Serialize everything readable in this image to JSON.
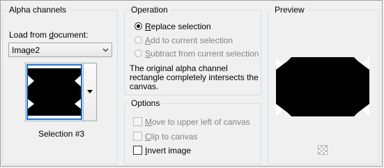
{
  "alpha": {
    "title": "Alpha channels",
    "load_label_pre": "Load from ",
    "load_label_u": "d",
    "load_label_post": "ocument:",
    "document_value": "Image2",
    "selection_label": "Selection #3"
  },
  "operation": {
    "title": "Operation",
    "replace": {
      "u": "R",
      "rest": "eplace selection",
      "selected": true,
      "enabled": true
    },
    "add": {
      "u": "A",
      "rest": "dd to current selection",
      "selected": false,
      "enabled": false
    },
    "subtract": {
      "u": "S",
      "rest": "ubtract from current selection",
      "selected": false,
      "enabled": false
    },
    "info_line1": "The original alpha channel",
    "info_line2": "rectangle completely intersects the",
    "info_line3": "canvas."
  },
  "options": {
    "title": "Options",
    "move": {
      "u": "M",
      "rest": "ove to upper left of canvas",
      "checked": false,
      "enabled": false
    },
    "clip": {
      "u": "C",
      "rest": "lip to canvas",
      "checked": false,
      "enabled": false
    },
    "invert": {
      "u": "I",
      "rest": "nvert image",
      "checked": false,
      "enabled": true
    }
  },
  "preview": {
    "title": "Preview",
    "transparency_icon": "transparency-checker-icon"
  },
  "colors": {
    "shape": "#000000",
    "selection_border": "#1f74d0",
    "group_border": "#d5dfe5",
    "disabled_text": "#838383"
  }
}
